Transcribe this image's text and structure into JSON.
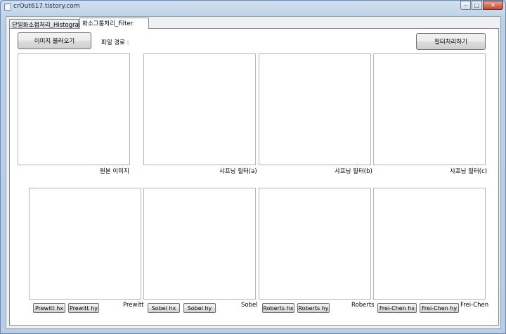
{
  "window": {
    "title": "crOut617.tistory.com",
    "minimize": "–",
    "maximize": "□",
    "close": "✕"
  },
  "tabs": [
    {
      "label": "단일화소점처리_Histogram"
    },
    {
      "label": "화소그룹처리_Filter"
    }
  ],
  "toolbar": {
    "load_label": "이미지 불러오기",
    "path_label": "파일 경로 :",
    "filter_label": "필터처리하기"
  },
  "top_images": [
    {
      "caption": "원본 이미지"
    },
    {
      "caption": "샤프닝 필터(a)"
    },
    {
      "caption": "샤프닝 필터(b)"
    },
    {
      "caption": "샤프닝 필터(c)"
    }
  ],
  "bottom_images": [
    {
      "caption": "Prewitt",
      "btn_x": "Prewitt hx",
      "btn_y": "Prewitt hy"
    },
    {
      "caption": "Sobel",
      "btn_x": "Sobel hx",
      "btn_y": "Sobel hy"
    },
    {
      "caption": "Roberts",
      "btn_x": "Roberts hx",
      "btn_y": "Roberts hy"
    },
    {
      "caption": "Frei-Chen",
      "btn_x": "Frei-Chen hx",
      "btn_y": "Frei-Chen hy"
    }
  ]
}
